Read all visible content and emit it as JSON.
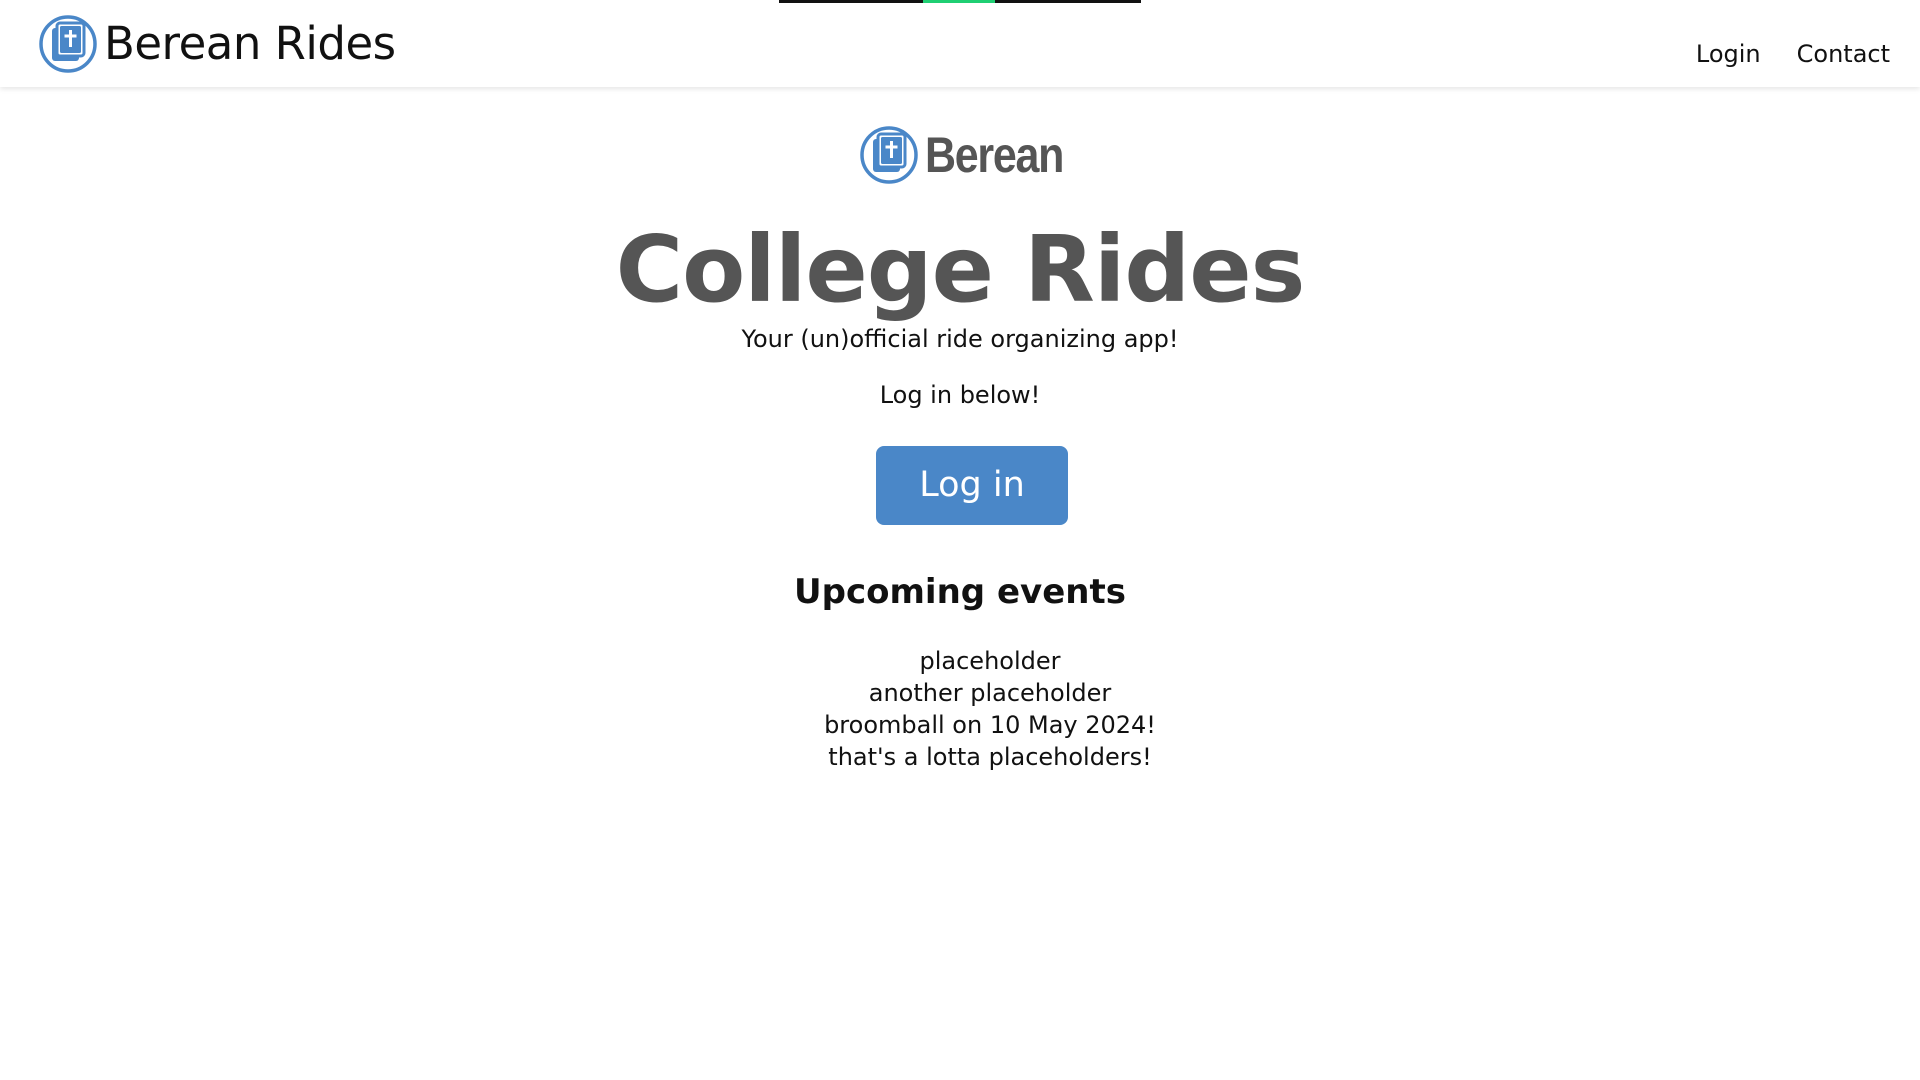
{
  "navbar": {
    "brand": "Berean Rides",
    "links": [
      "Login",
      "Contact"
    ]
  },
  "loading_progress": 0.2,
  "hero": {
    "logo_text": "Berean",
    "title": "College Rides",
    "tagline": "Your (un)official ride organizing app!",
    "login_prompt": "Log in below!",
    "login_button": "Log in"
  },
  "events": {
    "heading": "Upcoming events",
    "items": [
      "placeholder",
      "another placeholder",
      "broomball on 10 May 2024!",
      "that's a lotta placeholders!"
    ]
  },
  "colors": {
    "accent": "#4a87c8",
    "title": "#555555",
    "progress": "#1fcf73"
  }
}
